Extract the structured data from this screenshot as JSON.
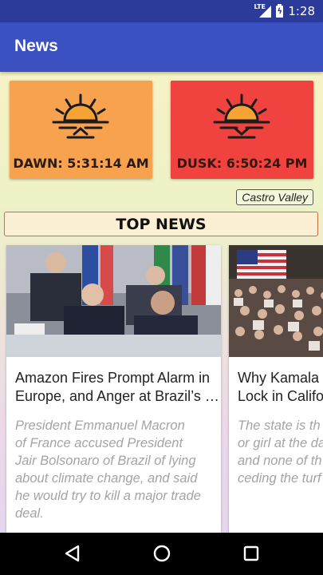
{
  "status_bar": {
    "network": "LTE",
    "time": "1:28"
  },
  "app_bar": {
    "title": "News"
  },
  "sun_cards": {
    "dawn": {
      "label": "DAWN: 5:31:14 AM",
      "color": "#f7a24e",
      "icon": "sunrise-icon"
    },
    "dusk": {
      "label": "DUSK: 6:50:24 PM",
      "color": "#f0433f",
      "icon": "sunset-icon"
    }
  },
  "location": "Castro Valley",
  "section_header": "TOP NEWS",
  "articles": [
    {
      "title_lines": [
        "Amazon Fires Prompt Alarm in",
        "Europe, and Anger at Brazil’s …"
      ],
      "description_lines": [
        "President Emmanuel Macron",
        "of France accused President",
        "Jair Bolsonaro of Brazil of lying",
        "about climate change, and said",
        "he would try to kill a major trade",
        "deal."
      ],
      "image": "g20-leaders-photo"
    },
    {
      "title_lines": [
        "Why Kamala H",
        "Lock in Califo"
      ],
      "description_lines": [
        "The state is th",
        "or girl at the da",
        "and none of th",
        "ceding the turf"
      ],
      "image": "rally-crowd-photo"
    }
  ],
  "nav_bar": {
    "back": "back-icon",
    "home": "home-icon",
    "recents": "recents-icon"
  }
}
